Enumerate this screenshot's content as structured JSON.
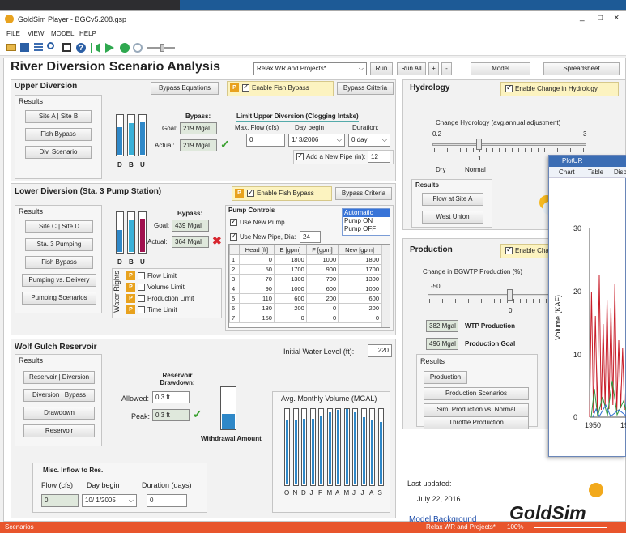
{
  "window": {
    "title": "GoldSim Player - BGCv5.208.gsp",
    "controls": [
      "_",
      "□",
      "×"
    ]
  },
  "menu": [
    "FILE",
    "VIEW",
    "MODEL",
    "HELP"
  ],
  "header": {
    "title": "River Diversion Scenario Analysis",
    "scenario": "Relax WR and Projects*",
    "run": "Run",
    "run_all": "Run All",
    "plus": "+",
    "minus": "-",
    "model": "Model",
    "spreadsheet": "Spreadsheet"
  },
  "upper": {
    "title": "Upper Diversion",
    "bypass_eq": "Bypass Equations",
    "p": "P",
    "enable": "Enable Fish Bypass",
    "criteria": "Bypass Criteria",
    "results": "Results",
    "buttons": [
      "Site A | Site B",
      "Fish Bypass",
      "Div. Scenario"
    ],
    "bypass_label": "Bypass:",
    "goal_label": "Goal:",
    "goal": "219 Mgal",
    "actual_label": "Actual:",
    "actual": "219 Mgal",
    "limit_title": "Limit Upper Diversion (Clogging Intake)",
    "maxflow_label": "Max. Flow (cfs)",
    "day_label": "Day begin",
    "dur_label": "Duration:",
    "maxflow": "0",
    "day": "1/ 3/2006",
    "dur": "0 day",
    "newpipe": "Add a New Pipe (in):",
    "pipe": "12",
    "tube_labels": [
      "D",
      "B",
      "U"
    ],
    "levels": [
      0.68,
      0.78,
      0.8
    ]
  },
  "lower": {
    "title": "Lower Diversion (Sta. 3 Pump Station)",
    "p": "P",
    "enable": "Enable Fish Bypass",
    "criteria": "Bypass Criteria",
    "results": "Results",
    "buttons": [
      "Site C | Site D",
      "Sta. 3 Pumping",
      "Fish Bypass",
      "Pumping vs. Delivery",
      "Pumping Scenarios"
    ],
    "bypass_label": "Bypass:",
    "goal_label": "Goal:",
    "goal": "439 Mgal",
    "actual_label": "Actual:",
    "actual": "364 Mgal",
    "wr_label": "Water Rights",
    "wr": [
      "Flow Limit",
      "Volume Limit",
      "Production Limit",
      "Time Limit"
    ],
    "pump_title": "Pump Controls",
    "use_pump": "Use New Pump",
    "use_pipe": "Use New Pipe, Dia:",
    "pipe_dia": "24",
    "modes": [
      "Automatic",
      "Pump ON",
      "Pump OFF"
    ],
    "table_headers": [
      "",
      "Head [ft]",
      "E [gpm]",
      "F [gpm]",
      "New [gpm]"
    ],
    "table_rows": [
      [
        "1",
        "0",
        "1800",
        "1000",
        "1800"
      ],
      [
        "2",
        "50",
        "1700",
        "900",
        "1700"
      ],
      [
        "3",
        "70",
        "1300",
        "700",
        "1300"
      ],
      [
        "4",
        "90",
        "1000",
        "600",
        "1000"
      ],
      [
        "5",
        "110",
        "600",
        "200",
        "600"
      ],
      [
        "6",
        "130",
        "200",
        "0",
        "200"
      ],
      [
        "7",
        "150",
        "0",
        "0",
        "0"
      ]
    ],
    "tube_labels": [
      "D",
      "B",
      "U"
    ],
    "levels": [
      0.55,
      0.78,
      0.82
    ]
  },
  "wolf": {
    "title": "Wolf Gulch Reservoir",
    "results": "Results",
    "buttons": [
      "Reservoir | Diversion",
      "Diversion | Bypass",
      "Drawdown",
      "Reservoir"
    ],
    "initial_label": "Initial Water Level (ft):",
    "initial": "220",
    "drawdown_title": "Reservoir Drawdown:",
    "allowed_label": "Allowed:",
    "allowed": "0.3 ft",
    "peak_label": "Peak:",
    "peak": "0.3 ft",
    "withdrawal": "Withdrawal Amount",
    "withdrawal_level": 0.35,
    "avg_title": "Avg. Monthly Volume (MGAL)",
    "months": [
      "O",
      "N",
      "D",
      "J",
      "F",
      "M",
      "A",
      "M",
      "J",
      "J",
      "A",
      "S"
    ],
    "month_levels": [
      0.85,
      0.84,
      0.86,
      0.86,
      0.9,
      0.95,
      0.98,
      0.99,
      0.95,
      0.88,
      0.84,
      0.82
    ],
    "misc_title": "Misc. Inflow to Res.",
    "flow_label": "Flow (cfs)",
    "day_label": "Day begin",
    "dur_label": "Duration (days)",
    "flow": "0",
    "day": "10/ 1/2005",
    "dur": "0"
  },
  "hydrology": {
    "title": "Hydrology",
    "enable": "Enable Change in Hydrology",
    "slider_title": "Change Hydrology (avg.annual adjustment)",
    "min": "0.2",
    "max": "3",
    "value": "1",
    "dry": "Dry",
    "normal": "Normal",
    "results": "Results",
    "buttons": [
      "Flow at Site A",
      "West Union"
    ]
  },
  "production": {
    "title": "Production",
    "enable": "Enable Cha",
    "slider_title": "Change in BGWTP Production (%)",
    "min": "-50",
    "value": "0",
    "wtp": "382 Mgal",
    "wtp_label": "WTP Production",
    "goal": "496 Mgal",
    "goal_label": "Production Goal",
    "results": "Results",
    "buttons": [
      "Production",
      "Production Scenarios",
      "Sim. Production vs. Normal",
      "Throttle Production"
    ]
  },
  "footer": {
    "last_updated_label": "Last updated:",
    "last_updated": "July 22, 2016",
    "background_link": "Model Background",
    "logo": "GoldSim"
  },
  "plot": {
    "title": "PlotUR",
    "tabs": [
      "Chart",
      "Table",
      "Displ"
    ],
    "ylabel": "Volume (KAF)",
    "yticks": [
      "30",
      "20",
      "10",
      "0"
    ],
    "xticks": [
      "1950",
      "19"
    ]
  },
  "statusbar": {
    "left": "Scenarios",
    "scenario": "Relax WR and Projects*",
    "zoom": "100%"
  },
  "colors": {
    "blue": "#2f88c8",
    "crimson": "#a0104e",
    "green_check": "#3aa02f",
    "red_x": "#d7262e",
    "orange": "#e8a21e",
    "accent": "#e8552c"
  }
}
